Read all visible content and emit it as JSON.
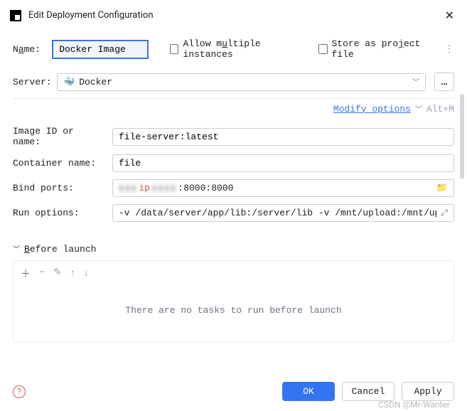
{
  "title": "Edit Deployment Configuration",
  "name": {
    "label_pre": "N",
    "label_u": "a",
    "label_post": "me:",
    "value": "Docker Image"
  },
  "allow_multiple": {
    "label_pre": "Allow m",
    "label_u": "u",
    "label_post": "ltiple instances"
  },
  "store_as": {
    "label_pre": "Store as pro",
    "label_u": "j",
    "label_post": "ect file"
  },
  "server": {
    "label": "Server:",
    "value": "Docker"
  },
  "modify": {
    "label": "Modify options",
    "shortcut": "Alt+M"
  },
  "fields": {
    "image_id": {
      "label": "Image ID or name:",
      "value": "file-server:latest"
    },
    "container_name": {
      "label": "Container name:",
      "value": "file"
    },
    "bind_ports": {
      "label": "Bind ports:",
      "masked_prefix": "▮▮▮",
      "ip_marker": "ip",
      "masked_mid": "▮▮▮▮",
      "suffix": ":8000:8000"
    },
    "run_options": {
      "label": "Run options:",
      "value": "-v /data/server/app/lib:/server/lib -v /mnt/upload:/mnt/upload"
    }
  },
  "before_launch": {
    "label_u": "B",
    "label_post": "efore launch",
    "empty_text": "There are no tasks to run before launch"
  },
  "buttons": {
    "ok": "OK",
    "cancel": "Cancel",
    "apply": "Apply"
  },
  "watermark": "CSDN @Mr-Wanter"
}
